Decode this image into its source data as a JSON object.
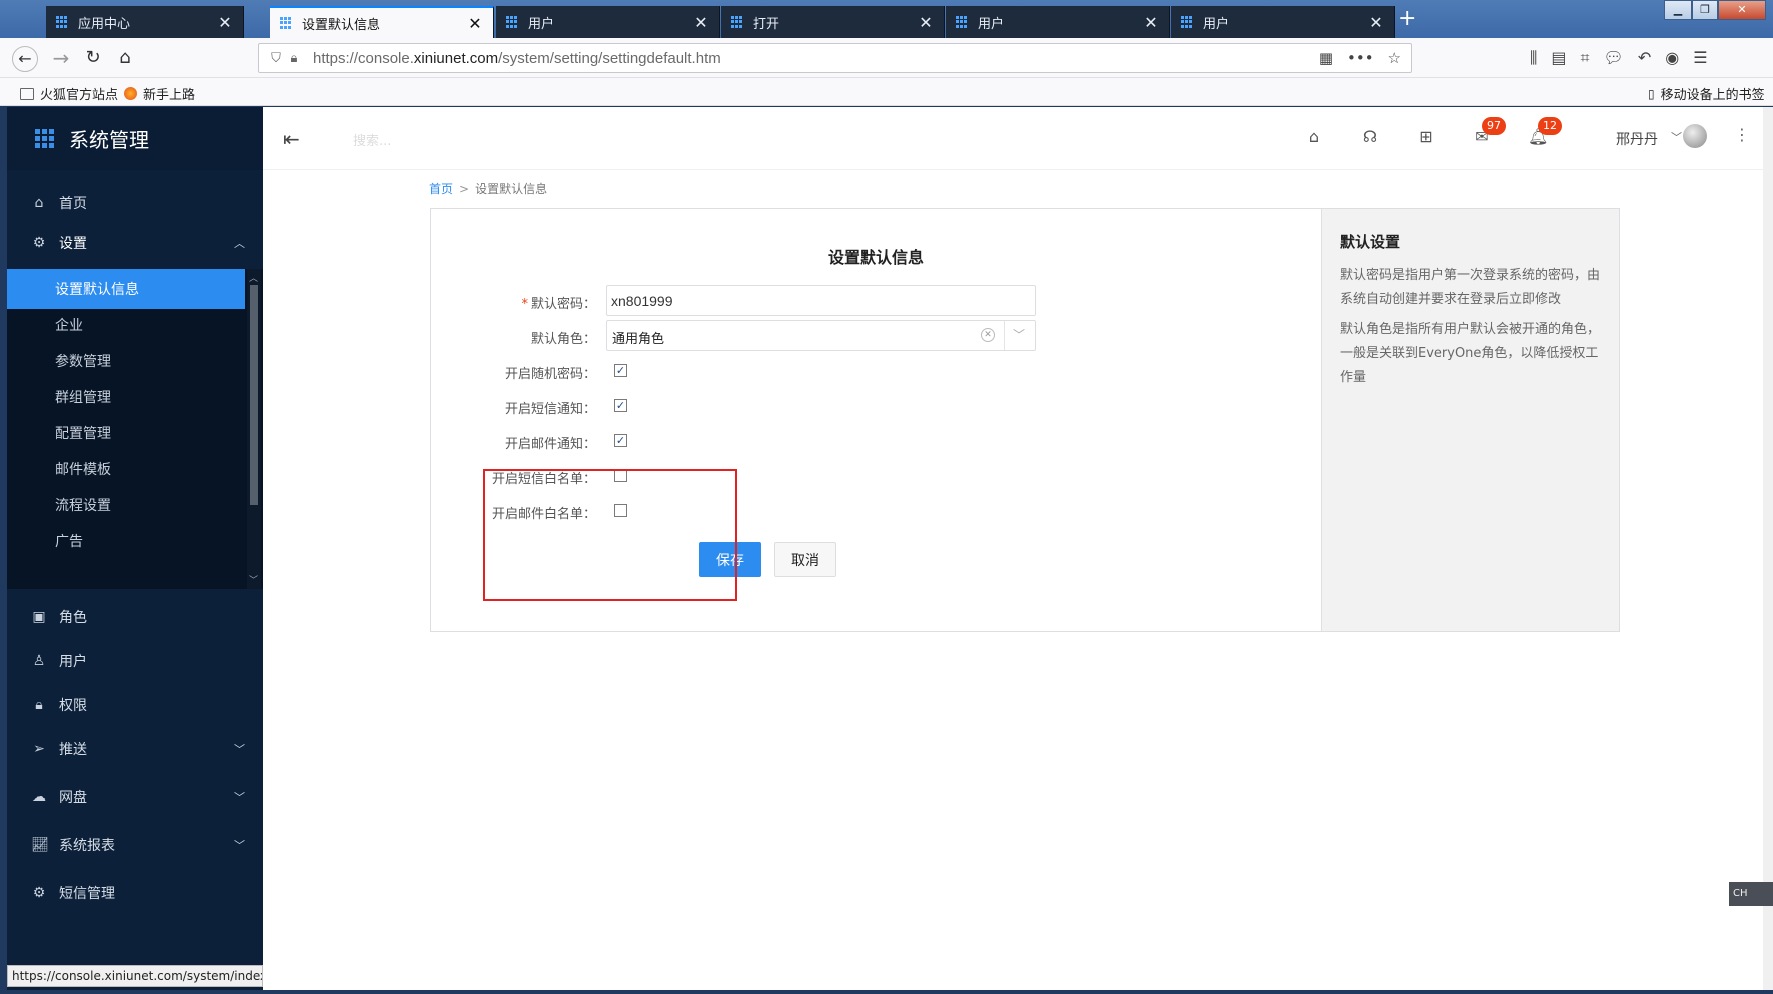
{
  "browser": {
    "tabs": [
      {
        "title": "应用中心",
        "active": false
      },
      {
        "title": "设置默认信息",
        "active": true
      },
      {
        "title": "用户",
        "active": false
      },
      {
        "title": "打开",
        "active": false
      },
      {
        "title": "用户",
        "active": false
      },
      {
        "title": "用户",
        "active": false
      }
    ],
    "tab_close": "✕",
    "new_tab": "+",
    "url_prefix": "https://console.",
    "url_domain": "xiniunet.com",
    "url_path": "/system/setting/settingdefault.htm",
    "bookmarks": [
      "火狐官方站点",
      "新手上路"
    ],
    "mobile_bookmarks": "移动设备上的书签",
    "status_url": "https://console.xiniunet.com/system/index"
  },
  "app": {
    "brand": "系统管理",
    "search_placeholder": "搜索...",
    "username": "邢丹丹",
    "mail_count": "97",
    "notify_count": "12"
  },
  "sidebar": {
    "top_items": [
      {
        "label": "首页",
        "icon": "home-icon"
      },
      {
        "label": "设置",
        "icon": "gear-icon"
      }
    ],
    "sub_items": [
      "设置默认信息",
      "企业",
      "参数管理",
      "群组管理",
      "配置管理",
      "邮件模板",
      "流程设置",
      "广告"
    ],
    "bottom_items": [
      {
        "label": "角色",
        "icon": "id-card-icon"
      },
      {
        "label": "用户",
        "icon": "user-icon"
      },
      {
        "label": "权限",
        "icon": "lock-icon"
      },
      {
        "label": "推送",
        "icon": "send-icon"
      },
      {
        "label": "网盘",
        "icon": "cloud-icon"
      },
      {
        "label": "系统报表",
        "icon": "chart-icon"
      },
      {
        "label": "短信管理",
        "icon": "gear-icon"
      }
    ]
  },
  "breadcrumb": {
    "home": "首页",
    "separator": ">",
    "current": "设置默认信息"
  },
  "form": {
    "title": "设置默认信息",
    "password_label": "默认密码：",
    "password_required": "*",
    "password_value": "xn801999",
    "role_label": "默认角色：",
    "role_value": "通用角色",
    "checkboxes": [
      {
        "label": "开启随机密码：",
        "checked": true
      },
      {
        "label": "开启短信通知：",
        "checked": true
      },
      {
        "label": "开启邮件通知：",
        "checked": true
      },
      {
        "label": "开启短信白名单：",
        "checked": false
      },
      {
        "label": "开启邮件白名单：",
        "checked": false
      }
    ],
    "save_label": "保存",
    "cancel_label": "取消"
  },
  "aside": {
    "title": "默认设置",
    "paragraphs": [
      "默认密码是指用户第一次登录系统的密码，由系统自动创建并要求在登录后立即修改",
      "默认角色是指所有用户默认会被开通的角色，一般是关联到EveryOne角色，以降低授权工作量"
    ]
  },
  "float_tag": "CH",
  "colors": {
    "primary": "#2d8cf0",
    "sidebar_bg": "#0c2139",
    "highlight": "#e02222",
    "badge": "#ed3f14"
  }
}
